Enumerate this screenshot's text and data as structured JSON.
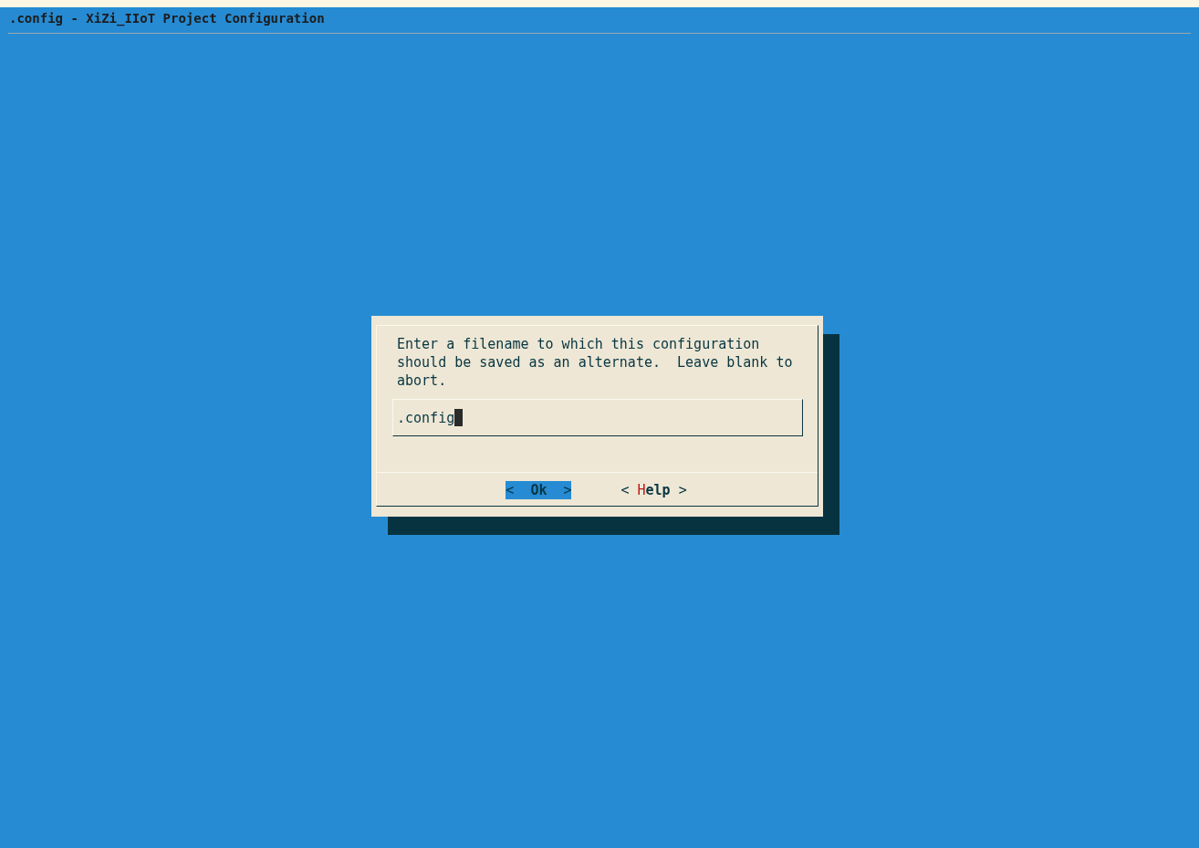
{
  "window": {
    "title": ".config - XiZi_IIoT Project Configuration"
  },
  "dialog": {
    "message": "Enter a filename to which this configuration should be saved as an alternate.  Leave blank to abort.",
    "input": {
      "value": ".config"
    },
    "buttons": [
      {
        "left": "<",
        "label": "Ok",
        "right": ">",
        "selected": true
      },
      {
        "left": "<",
        "label": "Help",
        "right": ">",
        "selected": false
      }
    ]
  }
}
